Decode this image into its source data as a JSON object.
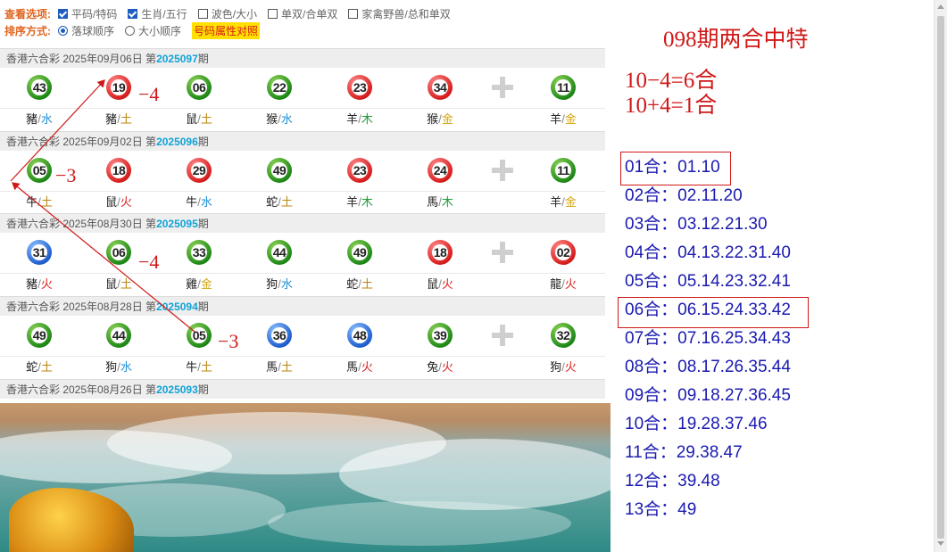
{
  "options": {
    "view_label": "查看选项:",
    "view_items": [
      {
        "label": "平码/特码",
        "checked": true
      },
      {
        "label": "生肖/五行",
        "checked": true
      },
      {
        "label": "波色/大小",
        "checked": false
      },
      {
        "label": "单双/合单双",
        "checked": false
      },
      {
        "label": "家禽野兽/总和单双",
        "checked": false
      }
    ],
    "sort_label": "排序方式:",
    "sort_items": [
      {
        "label": "落球顺序",
        "selected": true
      },
      {
        "label": "大小顺序",
        "selected": false
      }
    ],
    "compare_button": "号码属性对照"
  },
  "draws": [
    {
      "prefix": "香港六合彩 2025年09月06日 第",
      "number": "2025097",
      "suffix": "期",
      "balls": [
        {
          "num": "43",
          "color": "green",
          "zodiac": "豬",
          "element": "水",
          "el": "water"
        },
        {
          "num": "19",
          "color": "red",
          "zodiac": "豬",
          "element": "土",
          "el": "earth"
        },
        {
          "num": "06",
          "color": "green",
          "zodiac": "鼠",
          "element": "土",
          "el": "earth"
        },
        {
          "num": "22",
          "color": "green",
          "zodiac": "猴",
          "element": "水",
          "el": "water"
        },
        {
          "num": "23",
          "color": "red",
          "zodiac": "羊",
          "element": "木",
          "el": "wood"
        },
        {
          "num": "34",
          "color": "red",
          "zodiac": "猴",
          "element": "金",
          "el": "metal"
        }
      ],
      "special": {
        "num": "11",
        "color": "green",
        "zodiac": "羊",
        "element": "金",
        "el": "metal"
      }
    },
    {
      "prefix": "香港六合彩 2025年09月02日 第",
      "number": "2025096",
      "suffix": "期",
      "balls": [
        {
          "num": "05",
          "color": "green",
          "zodiac": "牛",
          "element": "土",
          "el": "earth"
        },
        {
          "num": "18",
          "color": "red",
          "zodiac": "鼠",
          "element": "火",
          "el": "fire"
        },
        {
          "num": "29",
          "color": "red",
          "zodiac": "牛",
          "element": "水",
          "el": "water"
        },
        {
          "num": "49",
          "color": "green",
          "zodiac": "蛇",
          "element": "土",
          "el": "earth"
        },
        {
          "num": "23",
          "color": "red",
          "zodiac": "羊",
          "element": "木",
          "el": "wood"
        },
        {
          "num": "24",
          "color": "red",
          "zodiac": "馬",
          "element": "木",
          "el": "wood"
        }
      ],
      "special": {
        "num": "11",
        "color": "green",
        "zodiac": "羊",
        "element": "金",
        "el": "metal"
      }
    },
    {
      "prefix": "香港六合彩 2025年08月30日 第",
      "number": "2025095",
      "suffix": "期",
      "balls": [
        {
          "num": "31",
          "color": "blue",
          "zodiac": "豬",
          "element": "火",
          "el": "fire"
        },
        {
          "num": "06",
          "color": "green",
          "zodiac": "鼠",
          "element": "土",
          "el": "earth"
        },
        {
          "num": "33",
          "color": "green",
          "zodiac": "雞",
          "element": "金",
          "el": "metal"
        },
        {
          "num": "44",
          "color": "green",
          "zodiac": "狗",
          "element": "水",
          "el": "water"
        },
        {
          "num": "49",
          "color": "green",
          "zodiac": "蛇",
          "element": "土",
          "el": "earth"
        },
        {
          "num": "18",
          "color": "red",
          "zodiac": "鼠",
          "element": "火",
          "el": "fire"
        }
      ],
      "special": {
        "num": "02",
        "color": "red",
        "zodiac": "龍",
        "element": "火",
        "el": "fire"
      }
    },
    {
      "prefix": "香港六合彩 2025年08月28日 第",
      "number": "2025094",
      "suffix": "期",
      "balls": [
        {
          "num": "49",
          "color": "green",
          "zodiac": "蛇",
          "element": "土",
          "el": "earth"
        },
        {
          "num": "44",
          "color": "green",
          "zodiac": "狗",
          "element": "水",
          "el": "water"
        },
        {
          "num": "05",
          "color": "green",
          "zodiac": "牛",
          "element": "土",
          "el": "earth"
        },
        {
          "num": "36",
          "color": "blue",
          "zodiac": "馬",
          "element": "土",
          "el": "earth"
        },
        {
          "num": "48",
          "color": "blue",
          "zodiac": "馬",
          "element": "火",
          "el": "fire"
        },
        {
          "num": "39",
          "color": "green",
          "zodiac": "兔",
          "element": "火",
          "el": "fire"
        }
      ],
      "special": {
        "num": "32",
        "color": "green",
        "zodiac": "狗",
        "element": "火",
        "el": "fire"
      }
    }
  ],
  "last_header": {
    "prefix": "香港六合彩 2025年08月26日 第",
    "number": "2025093",
    "suffix": "期"
  },
  "annotations": [
    "−4",
    "−3",
    "−4",
    "−3"
  ],
  "right": {
    "title": "098期两合中特",
    "calc": [
      "10−4=6合",
      "10+4=1合"
    ],
    "he_list": [
      "01合：01.10",
      "02合：02.11.20",
      "03合：03.12.21.30",
      "04合：04.13.22.31.40",
      "05合：05.14.23.32.41",
      "06合：06.15.24.33.42",
      "07合：07.16.25.34.43",
      "08合：08.17.26.35.44",
      "09合：09.18.27.36.45",
      "10合：19.28.37.46",
      "11合：29.38.47",
      "12合：39.48",
      "13合：49"
    ]
  },
  "colors": {
    "annotation_red": "#d01818",
    "list_blue": "#1a1ab0",
    "issue_blue": "#11a3d6",
    "option_orange": "#e0641e"
  }
}
